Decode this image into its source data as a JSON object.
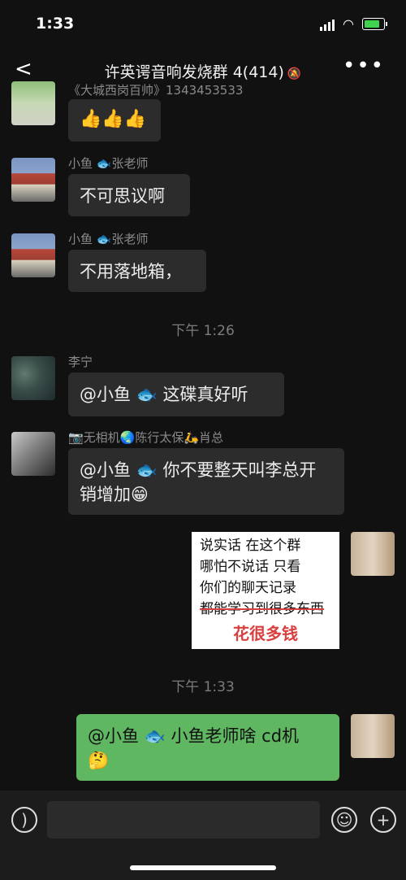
{
  "status": {
    "time": "1:33"
  },
  "header": {
    "back": "<",
    "title": "许英谔音响发烧群 4(414)",
    "mute_icon": "bell-slash-icon",
    "more": "•••"
  },
  "messages": {
    "m0": {
      "name_partial": "《大城西岗百帅》1343453533",
      "text": "👍👍👍"
    },
    "m1": {
      "sender": "小鱼 🐟张老师",
      "text": "不可思议啊"
    },
    "m2": {
      "sender": "小鱼 🐟张老师",
      "text": "不用落地箱，"
    },
    "t1": "下午 1:26",
    "m3": {
      "sender": "李宁",
      "text": "@小鱼 🐟 这碟真好听"
    },
    "m4": {
      "sender": "📷无相机🌏陈行太保🛵肖总",
      "text": "@小鱼 🐟 你不要整天叫李总开销增加😁"
    },
    "m5": {
      "lines": [
        "说实话  在这个群",
        "哪怕不说话  只看",
        "你们的聊天记录",
        "都能学习到很多东西"
      ],
      "red": "花很多钱"
    },
    "t2": "下午 1:33",
    "m6": {
      "text": "@小鱼 🐟 小鱼老师啥 cd机",
      "emoji": "🤔"
    }
  },
  "input": {
    "voice_icon": "voice-icon",
    "emoji_icon": "emoji-icon",
    "plus_icon": "plus-icon"
  }
}
